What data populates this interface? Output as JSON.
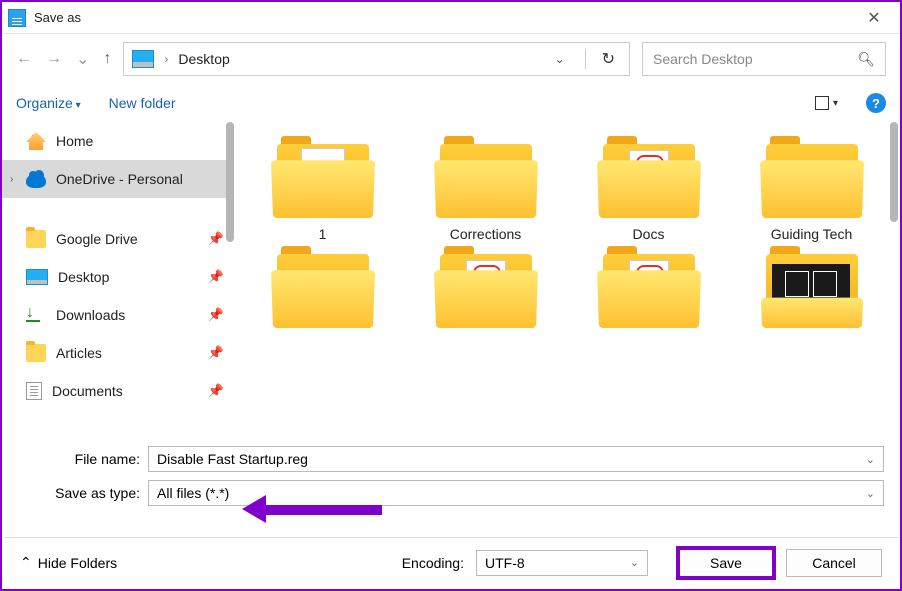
{
  "title": "Save as",
  "breadcrumb": "Desktop",
  "search_placeholder": "Search Desktop",
  "toolbar": {
    "organize": "Organize",
    "new_folder": "New folder"
  },
  "sidebar": {
    "items": [
      {
        "label": "Home"
      },
      {
        "label": "OneDrive - Personal"
      },
      {
        "label": "Google Drive"
      },
      {
        "label": "Desktop"
      },
      {
        "label": "Downloads"
      },
      {
        "label": "Articles"
      },
      {
        "label": "Documents"
      }
    ]
  },
  "folders": [
    {
      "name": "1",
      "variant": "paper"
    },
    {
      "name": "Corrections",
      "variant": "plain"
    },
    {
      "name": "Docs",
      "variant": "pdf"
    },
    {
      "name": "Guiding Tech",
      "variant": "plain"
    },
    {
      "name": "",
      "variant": "plain"
    },
    {
      "name": "",
      "variant": "pdf"
    },
    {
      "name": "",
      "variant": "pdf"
    },
    {
      "name": "",
      "variant": "dark"
    }
  ],
  "form": {
    "filename_label": "File name:",
    "filename_value": "Disable Fast Startup.reg",
    "type_label": "Save as type:",
    "type_value": "All files  (*.*)"
  },
  "footer": {
    "hide": "Hide Folders",
    "encoding_label": "Encoding:",
    "encoding_value": "UTF-8",
    "save": "Save",
    "cancel": "Cancel"
  }
}
